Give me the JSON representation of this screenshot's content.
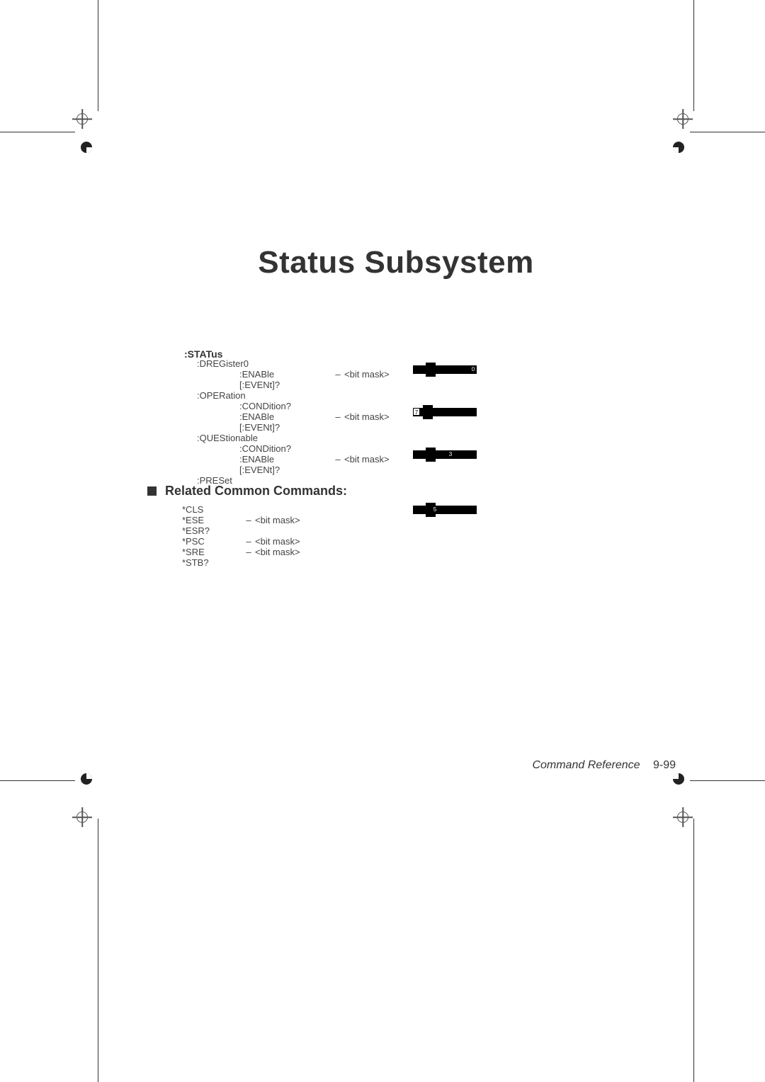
{
  "title": "Status Subsystem",
  "root": ":STATus",
  "tree": {
    "dreg": {
      "label": ":DREGister0",
      "enable": ":ENABle",
      "enable_arg": "<bit mask>",
      "event": "[:EVENt]?"
    },
    "oper": {
      "label": ":OPERation",
      "cond": ":CONDition?",
      "enable": ":ENABle",
      "enable_arg": "<bit mask>",
      "event": "[:EVENt]?"
    },
    "ques": {
      "label": ":QUEStionable",
      "cond": ":CONDition?",
      "enable": ":ENABle",
      "enable_arg": "<bit mask>",
      "event": "[:EVENt]?"
    },
    "preset": ":PRESet"
  },
  "section_heading": "Related Common Commands:",
  "common": {
    "cls": "*CLS",
    "ese": "*ESE",
    "ese_arg": "<bit mask>",
    "esr": "*ESR?",
    "psc": "*PSC",
    "psc_arg": "<bit mask>",
    "sre": "*SRE",
    "sre_arg": "<bit mask>",
    "stb": "*STB?"
  },
  "tabs": {
    "t1": "0",
    "t2": "7",
    "t3": "3",
    "t4": "5"
  },
  "footer": {
    "label": "Command Reference",
    "page": "9-99"
  },
  "sep": "–"
}
